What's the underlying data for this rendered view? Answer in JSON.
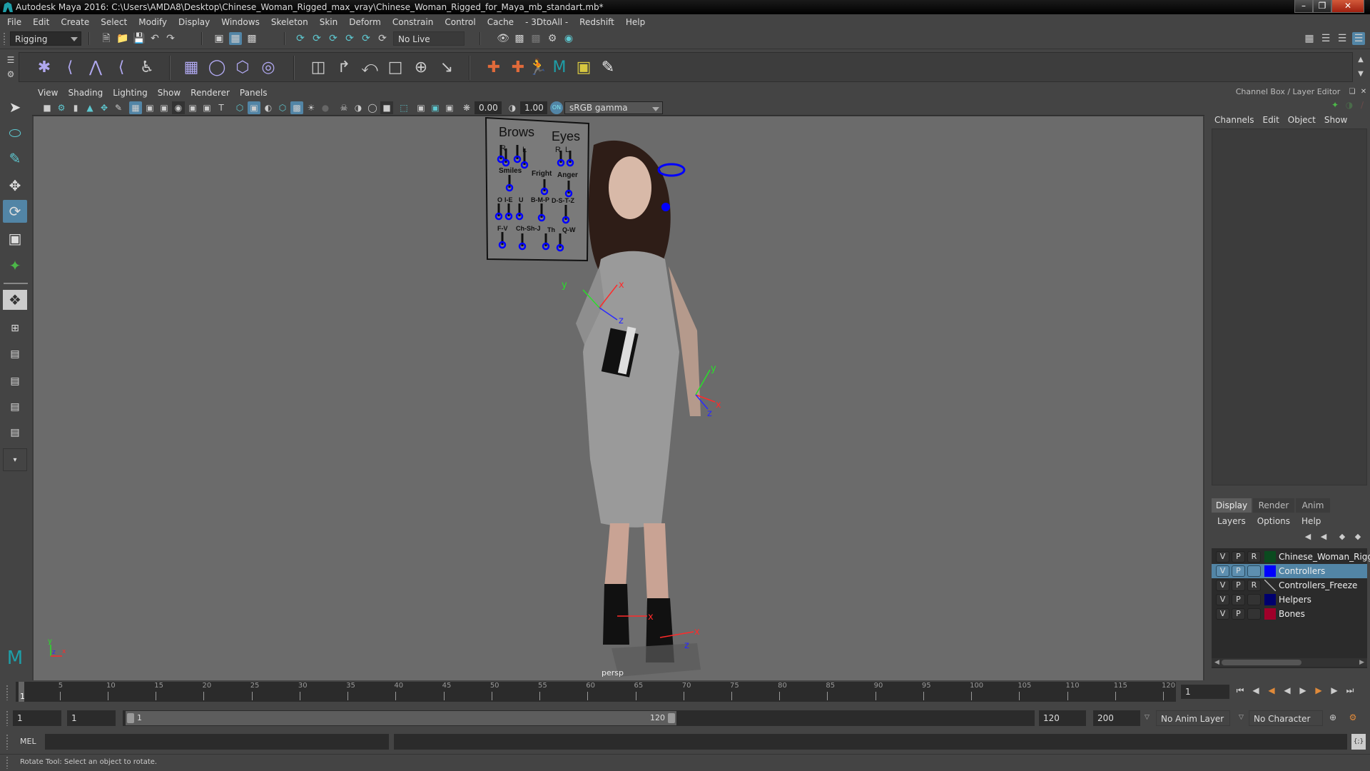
{
  "window": {
    "title": "Autodesk Maya 2016: C:\\Users\\AMDA8\\Desktop\\Chinese_Woman_Rigged_max_vray\\Chinese_Woman_Rigged_for_Maya_mb_standart.mb*",
    "minimize": "–",
    "restore": "❐",
    "close": "✕"
  },
  "menubar": [
    "File",
    "Edit",
    "Create",
    "Select",
    "Modify",
    "Display",
    "Windows",
    "Skeleton",
    "Skin",
    "Deform",
    "Constrain",
    "Control",
    "Cache",
    "- 3DtoAll -",
    "Redshift",
    "Help"
  ],
  "toolbar": {
    "menuset": "Rigging",
    "live_surface": "No Live Surface"
  },
  "shelf": {
    "tools": [
      "joint-tool",
      "ik-handle",
      "ik-spline",
      "insert-joint",
      "humanik",
      "bind-skin",
      "paint-weights",
      "lattice",
      "cluster",
      "parent-constraint",
      "point-constraint",
      "orient-constraint",
      "scale-constraint",
      "aim-constraint",
      "pole-vector",
      "locator",
      "parent-locator",
      "human-ik-character",
      "maya-logo",
      "layers",
      "3dtoall"
    ]
  },
  "toolbox": [
    "select-tool",
    "lasso-tool",
    "paint-select-tool",
    "move-tool",
    "rotate-tool",
    "scale-tool",
    "universal-manipulator"
  ],
  "panel": {
    "menus": [
      "View",
      "Shading",
      "Lighting",
      "Show",
      "Renderer",
      "Panels"
    ],
    "exposure": "0.00",
    "gamma": "1.00",
    "color_mgmt_toggle": "ON",
    "color_space": "sRGB gamma",
    "camera_label": "persp"
  },
  "viewport": {
    "face_panel": {
      "labels": [
        "Brows",
        "Eyes",
        "R",
        "L",
        "R",
        "L",
        "Smiles",
        "Fright",
        "Anger",
        "O",
        "I-E",
        "U",
        "B-M-P",
        "D-S-T-Z",
        "F-V",
        "Ch-Sh-J",
        "Th",
        "Q-W"
      ]
    },
    "axes": {
      "x": "x",
      "y": "y",
      "z": "z"
    }
  },
  "right_panel": {
    "title": "Channel Box / Layer Editor",
    "menus": [
      "Channels",
      "Edit",
      "Object",
      "Show"
    ],
    "layer_tabs": [
      {
        "label": "Display",
        "active": true
      },
      {
        "label": "Render",
        "active": false
      },
      {
        "label": "Anim",
        "active": false
      }
    ],
    "layer_menus": [
      "Layers",
      "Options",
      "Help"
    ],
    "layers": [
      {
        "v": "V",
        "p": "P",
        "r": "R",
        "color": "#0b4a1f",
        "name": "Chinese_Woman_Rigge",
        "selected": false
      },
      {
        "v": "V",
        "p": "P",
        "r": "",
        "color": "#0000ff",
        "name": "Controllers",
        "selected": true
      },
      {
        "v": "V",
        "p": "P",
        "r": "R",
        "color": "",
        "name": "Controllers_Freeze",
        "selected": false
      },
      {
        "v": "V",
        "p": "P",
        "r": "",
        "color": "#00006e",
        "name": "Helpers",
        "selected": false
      },
      {
        "v": "V",
        "p": "P",
        "r": "",
        "color": "#a0002a",
        "name": "Bones",
        "selected": false
      }
    ]
  },
  "timeline": {
    "ticks": [
      "5",
      "10",
      "15",
      "20",
      "25",
      "30",
      "35",
      "40",
      "45",
      "50",
      "55",
      "60",
      "65",
      "70",
      "75",
      "80",
      "85",
      "90",
      "95",
      "100",
      "105",
      "110",
      "115",
      "120"
    ],
    "current_frame_marker": "1",
    "current_frame": "1"
  },
  "range": {
    "start": "1",
    "playback_start": "1",
    "slider_start": "1",
    "slider_end": "120",
    "playback_end": "120",
    "end": "200",
    "anim_layer": "No Anim Layer",
    "character_set": "No Character Set"
  },
  "command": {
    "language": "MEL"
  },
  "status": {
    "help_text": "Rotate Tool: Select an object to rotate."
  }
}
